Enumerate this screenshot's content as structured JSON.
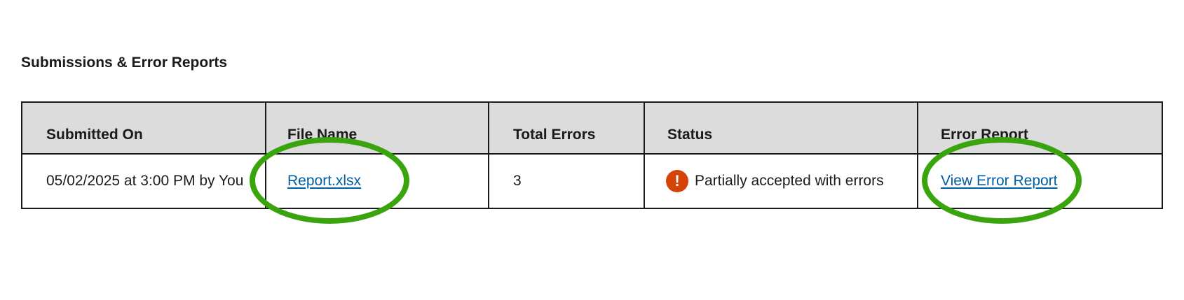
{
  "section": {
    "title": "Submissions & Error Reports"
  },
  "table": {
    "headers": {
      "submitted_on": "Submitted On",
      "file_name": "File Name",
      "total_errors": "Total Errors",
      "status": "Status",
      "error_report": "Error Report"
    },
    "rows": [
      {
        "submitted_on": "05/02/2025 at 3:00 PM by You",
        "file_name": "Report.xlsx",
        "total_errors": "3",
        "status_icon": "alert-circle-icon",
        "status_icon_glyph": "!",
        "status": "Partially accepted with errors",
        "error_report": "View Error Report"
      }
    ]
  },
  "colors": {
    "link": "#005ea2",
    "header_bg": "#dcdcdc",
    "alert": "#d54309",
    "highlight": "#3aa40e"
  }
}
